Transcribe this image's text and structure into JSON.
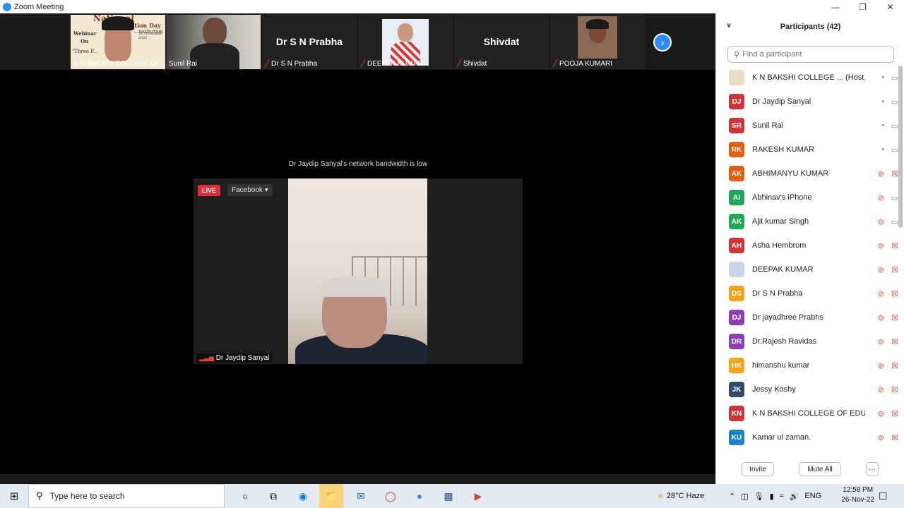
{
  "window": {
    "title": "Zoom Meeting"
  },
  "thumbnails": [
    {
      "name": "K N BAKSHI COLLEGE OF ...",
      "muted": false,
      "kind": "video"
    },
    {
      "name": "Sunil Rai",
      "muted": false,
      "kind": "video"
    },
    {
      "name": "Dr  S  N  Prabha",
      "muted": true,
      "kind": "name",
      "display": "Dr  S  N  Prabha"
    },
    {
      "name": "DEEPAK KUMAR",
      "muted": true,
      "kind": "video"
    },
    {
      "name": "Shivdat",
      "muted": true,
      "kind": "name",
      "display": "Shivdat"
    },
    {
      "name": "POOJA KUMARI",
      "muted": true,
      "kind": "video"
    }
  ],
  "banner": {
    "lines": [
      "National",
      "Constitution Day",
      "Webinar",
      "On",
      "26 November 2022",
      "\"Three P...",
      "...nstitution"
    ]
  },
  "notice": "Dr Jaydip Sanyal's network bandwidth is low",
  "active_video": {
    "live_label": "LIVE",
    "stream_label": "Facebook ▾",
    "speaker_name": "Dr Jaydip Sanyal"
  },
  "participants_panel": {
    "title": "Participants (42)",
    "search_placeholder": "Find a participant",
    "participants": [
      {
        "initials": "",
        "name": "K N BAKSHI COLLEGE ... (Host, me)",
        "color": "#e8dcc4",
        "mic": "on",
        "cam": "on"
      },
      {
        "initials": "DJ",
        "name": "Dr Jaydip Sanyal",
        "color": "#d13438",
        "mic": "on",
        "cam": "on"
      },
      {
        "initials": "SR",
        "name": "Sunil Rai",
        "color": "#d13438",
        "mic": "on",
        "cam": "on"
      },
      {
        "initials": "RK",
        "name": "RAKESH KUMAR",
        "color": "#e25f10",
        "mic": "on",
        "cam": "on"
      },
      {
        "initials": "AK",
        "name": "ABHIMANYU KUMAR",
        "color": "#e25f10",
        "mic": "off",
        "cam": "off"
      },
      {
        "initials": "AI",
        "name": "Abhinav's iPhone",
        "color": "#1fa855",
        "mic": "off",
        "cam": "on"
      },
      {
        "initials": "AK",
        "name": "Ajit kumar Singh",
        "color": "#1fa855",
        "mic": "off",
        "cam": "on"
      },
      {
        "initials": "AH",
        "name": "Asha Hembrom",
        "color": "#d13438",
        "mic": "off",
        "cam": "off"
      },
      {
        "initials": "",
        "name": "DEEPAK KUMAR",
        "color": "#c9d6e8",
        "mic": "off",
        "cam": "off"
      },
      {
        "initials": "DS",
        "name": "Dr  S  N  Prabha",
        "color": "#f7a21b",
        "mic": "off",
        "cam": "off"
      },
      {
        "initials": "DJ",
        "name": "Dr jayadhree Prabhs",
        "color": "#8a3fb3",
        "mic": "off",
        "cam": "off"
      },
      {
        "initials": "DR",
        "name": "Dr.Rajesh Ravidas",
        "color": "#8a3fb3",
        "mic": "off",
        "cam": "off"
      },
      {
        "initials": "HK",
        "name": "himanshu kumar",
        "color": "#f7a21b",
        "mic": "off",
        "cam": "off"
      },
      {
        "initials": "JK",
        "name": "Jessy Koshy",
        "color": "#2f4e6b",
        "mic": "off",
        "cam": "off"
      },
      {
        "initials": "KN",
        "name": "K N BAKSHI COLLEGE OF EDUCA...",
        "color": "#d13438",
        "mic": "off",
        "cam": "off"
      },
      {
        "initials": "KU",
        "name": "Kamar ul zaman.",
        "color": "#1b82c9",
        "mic": "off",
        "cam": "off"
      }
    ],
    "footer": {
      "invite": "Invite",
      "mute_all": "Mute All",
      "more": "···"
    }
  },
  "taskbar": {
    "search_placeholder": "Type here to search",
    "weather": "28°C  Haze",
    "language": "ENG",
    "time": "12:58 PM",
    "date": "26-Nov-22"
  }
}
